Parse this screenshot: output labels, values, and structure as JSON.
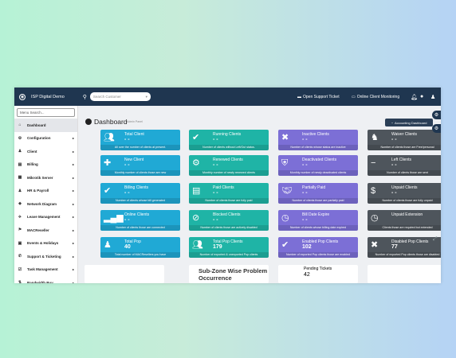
{
  "topbar": {
    "brand": "ISP Digital Demo",
    "search_placeholder": "Search Customer",
    "open_ticket": "Open Support Ticket",
    "online_monitor": "Online Client Monitoring"
  },
  "sidebar": {
    "search_placeholder": "Menu Search...",
    "items": [
      {
        "label": "Dashboard",
        "icon": "home-icon"
      },
      {
        "label": "Configuration",
        "icon": "gear-icon"
      },
      {
        "label": "Client",
        "icon": "user-icon"
      },
      {
        "label": "Billing",
        "icon": "billing-icon"
      },
      {
        "label": "Mikrotik Server",
        "icon": "server-icon"
      },
      {
        "label": "HR & Payroll",
        "icon": "users-icon"
      },
      {
        "label": "Network Diagram",
        "icon": "network-icon"
      },
      {
        "label": "Leave Management",
        "icon": "leave-icon"
      },
      {
        "label": "MACReseller",
        "icon": "reseller-icon"
      },
      {
        "label": "Events & Holidays",
        "icon": "calendar-icon"
      },
      {
        "label": "Support & Ticketing",
        "icon": "support-icon"
      },
      {
        "label": "Task Management",
        "icon": "task-icon"
      },
      {
        "label": "Bandwidth Buy",
        "icon": "bandwidth-icon"
      }
    ]
  },
  "main": {
    "title": "Dashboard",
    "subtitle": "Admin Panel",
    "accounting_button": "Accounting Dashboard"
  },
  "cards": [
    {
      "label": "Total Client",
      "value": "- -",
      "footer": "All over the number of clients at present.",
      "color": "#20a9d5",
      "icon": "users-icon"
    },
    {
      "label": "Running Clients",
      "value": "- -",
      "footer": "Number of clients without Left/Out status.",
      "color": "#1fb4a6",
      "icon": "user-check-icon"
    },
    {
      "label": "Inactive Clients",
      "value": "- -",
      "footer": "Number of clients whose status are inactive",
      "color": "#7c6fd6",
      "icon": "user-times-icon"
    },
    {
      "label": "Waiver Clients",
      "value": "- -",
      "footer": "Number of clients those are Free/personal",
      "color": "#4e555c",
      "icon": "user-secret-icon"
    },
    {
      "label": "New Client",
      "value": "- -",
      "footer": "Monthly number of clients those are new",
      "color": "#20a9d5",
      "icon": "user-plus-icon"
    },
    {
      "label": "Renewed Clients",
      "value": "- -",
      "footer": "Monthly number of newly renewed clients",
      "color": "#1fb4a6",
      "icon": "user-cog-icon"
    },
    {
      "label": "Deactivated Clients",
      "value": "- -",
      "footer": "Monthly number of newly deactivated clients",
      "color": "#7c6fd6",
      "icon": "user-shield-icon"
    },
    {
      "label": "Left Clients",
      "value": "- -",
      "footer": "Number of clients those are sent",
      "color": "#4e555c",
      "icon": "user-minus-icon"
    },
    {
      "label": "Billing Clients",
      "value": "- -",
      "footer": "Number of clients whose bill generated",
      "color": "#20a9d5",
      "icon": "user-check-icon"
    },
    {
      "label": "Paid Clients",
      "value": "- -",
      "footer": "Number of clients those are fully paid",
      "color": "#1fb4a6",
      "icon": "receipt-icon"
    },
    {
      "label": "Partially Paid",
      "value": "- -",
      "footer": "Number of clients those are partially paid",
      "color": "#7c6fd6",
      "icon": "handshake-icon"
    },
    {
      "label": "Unpaid Clients",
      "value": "- -",
      "footer": "Number of clients those are fully unpaid",
      "color": "#4e555c",
      "icon": "dollar-icon"
    },
    {
      "label": "Online Clients",
      "value": "- -",
      "footer": "Number of clients those are connected",
      "color": "#20a9d5",
      "icon": "signal-icon"
    },
    {
      "label": "Blocked Clients",
      "value": "- -",
      "footer": "Number of clients those are actively disabled",
      "color": "#1fb4a6",
      "icon": "user-slash-icon"
    },
    {
      "label": "Bill Date Expire",
      "value": "- -",
      "footer": "Number of clients whose billing date expired",
      "color": "#7c6fd6",
      "icon": "user-clock-icon"
    },
    {
      "label": "Unpaid Extension",
      "value": "",
      "footer": "Clients those are required but extended",
      "color": "#4e555c",
      "icon": "clock-icon"
    },
    {
      "label": "Total Pop",
      "value": "40",
      "footer": "Total number of MACResellers you have",
      "color": "#20a9d5",
      "icon": "user-icon"
    },
    {
      "label": "Total Pop Clients",
      "value": "179",
      "footer": "Number of exported & unexported Pop clients",
      "color": "#1fb4a6",
      "icon": "users-icon"
    },
    {
      "label": "Enabled Pop Clients",
      "value": "102",
      "footer": "Number of exported Pop clients those are enabled",
      "color": "#7c6fd6",
      "icon": "user-check-icon"
    },
    {
      "label": "Disabled Pop Clients",
      "value": "77",
      "footer": "Number of exported Pop clients those are disabled",
      "color": "#4e555c",
      "icon": "user-times-icon"
    }
  ],
  "bottom": {
    "subzone_title": "Sub-Zone Wise Problem Occurrence",
    "pending_label": "Pending Tickets",
    "pending_value": "42",
    "pending_color": "#d9332b"
  }
}
